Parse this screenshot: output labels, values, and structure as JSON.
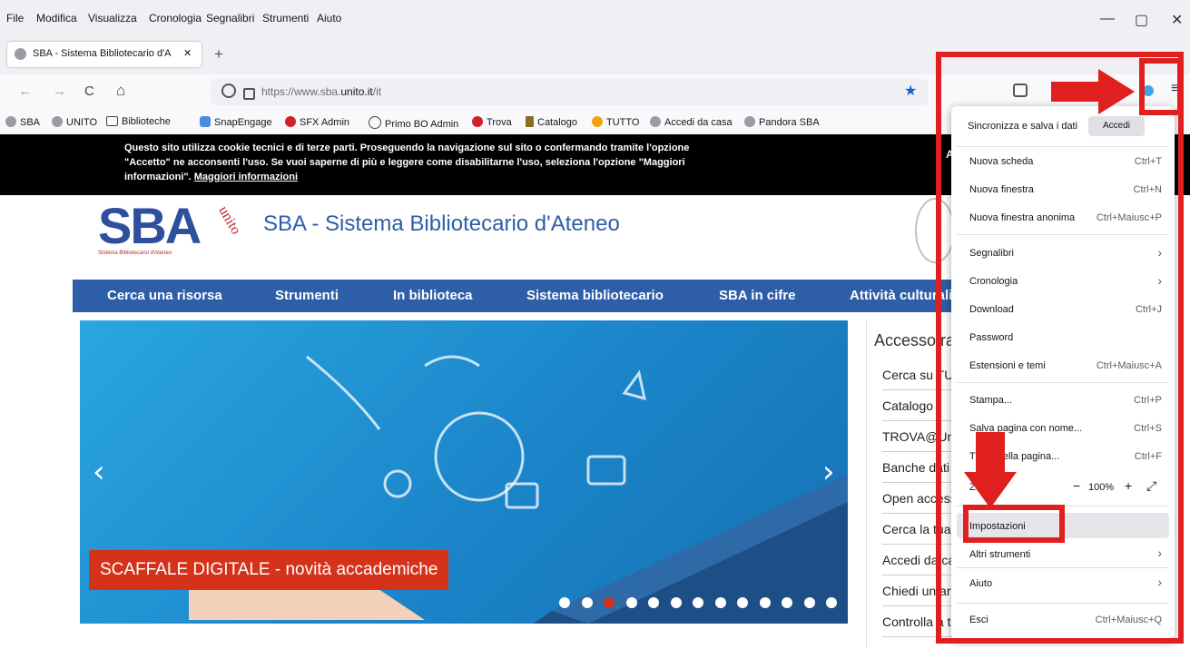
{
  "menubar": {
    "items": [
      "File",
      "Modifica",
      "Visualizza",
      "Cronologia",
      "Segnalibri",
      "Strumenti",
      "Aiuto"
    ],
    "minimize": "—",
    "restore": "▢",
    "close": "✕"
  },
  "tab": {
    "title": "SBA - Sistema Bibliotecario d'A",
    "close": "✕",
    "newtab": "+"
  },
  "nav": {
    "back": "←",
    "forward": "→",
    "reload": "C",
    "home": "⌂",
    "url_prefix": "https://www.sba.",
    "url_domain": "unito.it",
    "url_path": "/it",
    "star": "★"
  },
  "bookmarks": [
    "SBA",
    "UNITO",
    "Biblioteche",
    "SnapEngage",
    "SFX Admin",
    "Primo BO Admin",
    "Trova",
    "Catalogo",
    "TUTTO",
    "Accedi da casa",
    "Pandora SBA"
  ],
  "cookie": {
    "line1": "Questo sito utilizza cookie tecnici e di terze parti. Proseguendo la navigazione sul sito o confermando tramite l'opzione",
    "line2": "\"Accetto\" ne acconsenti l'uso. Se vuoi saperne di più e leggere come disabilitarne l'uso, seleziona l'opzione \"Maggiori",
    "line3a": "informazioni\". ",
    "line3b": "Maggiori informazioni"
  },
  "site": {
    "logo": "SBA",
    "logo_sub": "Sistema Bibliotecario d'Ateneo",
    "logo_unito": "unito",
    "title": "SBA - Sistema Bibliotecario d'Ateneo"
  },
  "navlinks": [
    "Cerca una risorsa",
    "Strumenti",
    "In biblioteca",
    "Sistema bibliotecario",
    "SBA in cifre",
    "Attività culturali"
  ],
  "slider": {
    "caption": "SCAFFALE DIGITALE - novità accademiche",
    "prev": "‹",
    "next": "›",
    "active_dot": 2,
    "dot_count": 14
  },
  "sidebar": {
    "heading": "Accesso ra",
    "items": [
      "Cerca su TUT",
      "Catalogo",
      "TROVA@Unito",
      "Banche dati c",
      "Open access",
      "Cerca la tua",
      "Accedi da ca",
      "Chiedi un art",
      "Controlla a tu"
    ]
  },
  "appmenu": {
    "sync_label": "Sincronizza e salva i dati",
    "sync_button": "Accedi",
    "items": [
      {
        "label": "Nuova scheda",
        "shortcut": "Ctrl+T"
      },
      {
        "label": "Nuova finestra",
        "shortcut": "Ctrl+N"
      },
      {
        "label": "Nuova finestra anonima",
        "shortcut": "Ctrl+Maiusc+P"
      },
      {
        "label": "Segnalibri",
        "shortcut": "›"
      },
      {
        "label": "Cronologia",
        "shortcut": "›"
      },
      {
        "label": "Download",
        "shortcut": "Ctrl+J"
      },
      {
        "label": "Password",
        "shortcut": ""
      },
      {
        "label": "Estensioni e temi",
        "shortcut": "Ctrl+Maiusc+A"
      },
      {
        "label": "Stampa...",
        "shortcut": "Ctrl+P"
      },
      {
        "label": "Salva pagina con nome...",
        "shortcut": "Ctrl+S"
      },
      {
        "label": "Trova nella pagina...",
        "shortcut": "Ctrl+F"
      },
      {
        "label": "Zoom",
        "shortcut": ""
      },
      {
        "label": "Impostazioni",
        "shortcut": ""
      },
      {
        "label": "Altri strumenti",
        "shortcut": "›"
      },
      {
        "label": "Aiuto",
        "shortcut": "›"
      },
      {
        "label": "Esci",
        "shortcut": "Ctrl+Maiusc+Q"
      }
    ],
    "zoom": {
      "minus": "−",
      "value": "100%",
      "plus": "+",
      "fullscreen": "⤢"
    }
  },
  "colors": {
    "annotation_red": "#e0201e",
    "nav_blue": "#2e5ea8",
    "caption_red": "#d5321b"
  }
}
